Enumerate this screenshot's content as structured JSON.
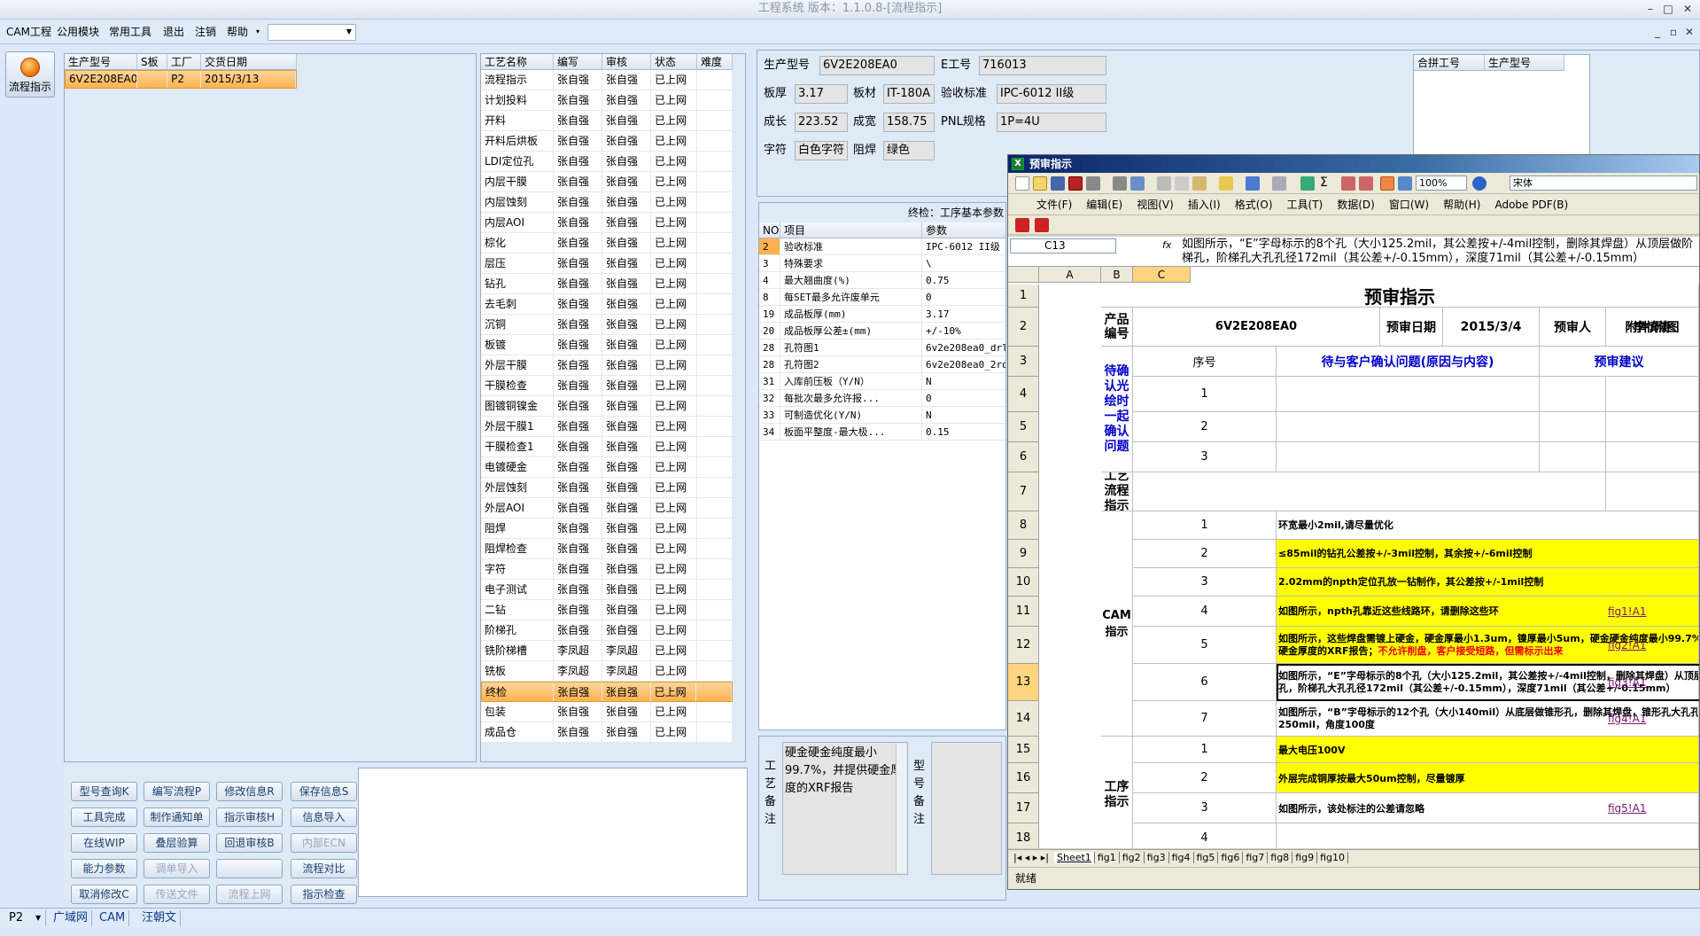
{
  "app": {
    "title": "工程系统 版本：1.1.0.8-[流程指示]"
  },
  "window_controls": {
    "min": "–",
    "max": "□",
    "close": "✕",
    "min2": "_",
    "restore2": "▫",
    "close2": "✕"
  },
  "menu": {
    "items": [
      "CAM工程",
      "公用模块",
      "常用工具",
      "退出",
      "注销",
      "帮助"
    ],
    "combo_value": ""
  },
  "side": {
    "flow_button": "流程指示"
  },
  "orders": {
    "headers": [
      "生产型号",
      "S板",
      "工厂",
      "交货日期"
    ],
    "rows": [
      [
        "6V2E208EA0",
        "",
        "P2",
        "2015/3/13"
      ]
    ]
  },
  "process": {
    "headers": [
      "工艺名称",
      "编写",
      "审核",
      "状态",
      "难度"
    ],
    "rows": [
      [
        "流程指示",
        "张自强",
        "张自强",
        "已上网",
        ""
      ],
      [
        "计划投料",
        "张自强",
        "张自强",
        "已上网",
        ""
      ],
      [
        "开料",
        "张自强",
        "张自强",
        "已上网",
        ""
      ],
      [
        "开料后烘板",
        "张自强",
        "张自强",
        "已上网",
        ""
      ],
      [
        "LDI定位孔",
        "张自强",
        "张自强",
        "已上网",
        ""
      ],
      [
        "内层干膜",
        "张自强",
        "张自强",
        "已上网",
        ""
      ],
      [
        "内层蚀刻",
        "张自强",
        "张自强",
        "已上网",
        ""
      ],
      [
        "内层AOI",
        "张自强",
        "张自强",
        "已上网",
        ""
      ],
      [
        "棕化",
        "张自强",
        "张自强",
        "已上网",
        ""
      ],
      [
        "层压",
        "张自强",
        "张自强",
        "已上网",
        ""
      ],
      [
        "钻孔",
        "张自强",
        "张自强",
        "已上网",
        ""
      ],
      [
        "去毛刺",
        "张自强",
        "张自强",
        "已上网",
        ""
      ],
      [
        "沉铜",
        "张自强",
        "张自强",
        "已上网",
        ""
      ],
      [
        "板镀",
        "张自强",
        "张自强",
        "已上网",
        ""
      ],
      [
        "外层干膜",
        "张自强",
        "张自强",
        "已上网",
        ""
      ],
      [
        "干膜检查",
        "张自强",
        "张自强",
        "已上网",
        ""
      ],
      [
        "图镀铜镍金",
        "张自强",
        "张自强",
        "已上网",
        ""
      ],
      [
        "外层干膜1",
        "张自强",
        "张自强",
        "已上网",
        ""
      ],
      [
        "干膜检查1",
        "张自强",
        "张自强",
        "已上网",
        ""
      ],
      [
        "电镀硬金",
        "张自强",
        "张自强",
        "已上网",
        ""
      ],
      [
        "外层蚀刻",
        "张自强",
        "张自强",
        "已上网",
        ""
      ],
      [
        "外层AOI",
        "张自强",
        "张自强",
        "已上网",
        ""
      ],
      [
        "阻焊",
        "张自强",
        "张自强",
        "已上网",
        ""
      ],
      [
        "阻焊检查",
        "张自强",
        "张自强",
        "已上网",
        ""
      ],
      [
        "字符",
        "张自强",
        "张自强",
        "已上网",
        ""
      ],
      [
        "电子测试",
        "张自强",
        "张自强",
        "已上网",
        ""
      ],
      [
        "二钻",
        "张自强",
        "张自强",
        "已上网",
        ""
      ],
      [
        "阶梯孔",
        "张自强",
        "张自强",
        "已上网",
        ""
      ],
      [
        "铣阶梯槽",
        "李凤超",
        "李凤超",
        "已上网",
        ""
      ],
      [
        "铣板",
        "李凤超",
        "李凤超",
        "已上网",
        ""
      ],
      [
        "终检",
        "张自强",
        "张自强",
        "已上网",
        ""
      ],
      [
        "包装",
        "张自强",
        "张自强",
        "已上网",
        ""
      ],
      [
        "成品仓",
        "张自强",
        "张自强",
        "已上网",
        ""
      ]
    ],
    "selected_index": 30
  },
  "buttons": [
    [
      "型号查询K",
      "编写流程P",
      "修改信息R",
      "保存信息S"
    ],
    [
      "工具完成",
      "制作通知单",
      "指示审核H",
      "信息导入"
    ],
    [
      "在线WIP",
      "叠层验算",
      "回退审核B",
      "内部ECN"
    ],
    [
      "能力参数",
      "调单导入",
      "",
      "流程对比"
    ],
    [
      "取消修改C",
      "传送文件",
      "流程上网",
      "指示检查"
    ]
  ],
  "disabled_buttons": [
    "内部ECN",
    "调单导入",
    "传送文件",
    "流程上网"
  ],
  "info": {
    "labels": {
      "model": "生产型号",
      "eno": "E工号",
      "thick": "板厚",
      "material": "板材",
      "accept": "验收标准",
      "len": "成长",
      "width": "成宽",
      "pnl": "PNL规格",
      "char": "字符",
      "mask": "阻焊"
    },
    "values": {
      "model": "6V2E208EA0",
      "eno": "716013",
      "thick": "3.17",
      "material": "IT-180A",
      "accept": "IPC-6012 II级",
      "len": "223.52",
      "width": "158.75",
      "pnl": "1P=4U",
      "char": "白色字符",
      "mask": "绿色"
    }
  },
  "merge": {
    "headers": [
      "合拼工号",
      "生产型号"
    ]
  },
  "params": {
    "caption": "终检：工序基本参数",
    "headers": [
      "NO",
      "项目",
      "参数"
    ],
    "rows": [
      [
        "2",
        "验收标准",
        "IPC-6012 II级"
      ],
      [
        "3",
        "特殊要求",
        "\\"
      ],
      [
        "4",
        "最大翘曲度(%)",
        "0.75"
      ],
      [
        "8",
        "每SET最多允许废单元",
        "0"
      ],
      [
        "19",
        "成品板厚(mm)",
        "3.17"
      ],
      [
        "20",
        "成品板厚公差±(mm)",
        "+/-10%"
      ],
      [
        "28",
        "孔符图1",
        "6v2e208ea0_drl_"
      ],
      [
        "28",
        "孔符图2",
        "6v2e208ea0_2rd_"
      ],
      [
        "31",
        "入库前压板（Y/N）",
        "N"
      ],
      [
        "32",
        "每批次最多允许报...",
        "0"
      ],
      [
        "33",
        "可制造优化(Y/N)",
        "N"
      ],
      [
        "34",
        "板面平整度-最大极...",
        "0.15"
      ]
    ],
    "selected_index": 0
  },
  "remark": {
    "label": "工艺备注",
    "text": "硬金硬金纯度最小99.7%，并提供硬金厚度的XRF报告",
    "label2": "型号备注"
  },
  "excel": {
    "title": "预审指示",
    "menu": [
      "文件(F)",
      "编辑(E)",
      "视图(V)",
      "插入(I)",
      "格式(O)",
      "工具(T)",
      "数据(D)",
      "窗口(W)",
      "帮助(H)",
      "Adobe PDF(B)"
    ],
    "zoom": "100%",
    "font": "宋体",
    "namebox": "C13",
    "fx": "fx",
    "formula": "如图所示，“E”字母标示的8个孔（大小125.2mil，其公差按+/-4mil控制，删除其焊盘）从顶层做阶梯孔，阶梯孔大孔孔径172mil（其公差+/-0.15mm），深度71mil（其公差+/-0.15mm）",
    "cols": [
      "A",
      "B",
      "C"
    ],
    "rows": [
      "1",
      "2",
      "3",
      "4",
      "5",
      "6",
      "7",
      "8",
      "9",
      "10",
      "11",
      "12",
      "13",
      "14",
      "15",
      "16",
      "17",
      "18",
      "5"
    ],
    "product_label": "产品编号",
    "product": "6V2E208EA0",
    "date_label": "预审日期",
    "date": "2015/3/4",
    "reviewer_label": "预审人",
    "reviewer": "李慎涛",
    "attach_label": "附件/附图",
    "seq_label": "序号",
    "issue_label": "待与客户确认问题(原因与内容)",
    "suggest_label": "预审建议",
    "pending_label": "待确认光绘时一起确认问题",
    "pending_seq": [
      "1",
      "2",
      "3"
    ],
    "flow_label": "工艺流程指示",
    "cam_label": "CAM指示",
    "proc_label": "工序指示",
    "cam_items": [
      {
        "n": "1",
        "t": "环宽最小2mil,请尽量优化",
        "y": false,
        "link": ""
      },
      {
        "n": "2",
        "t": "≤85mil的钻孔公差按+/-3mil控制，其余按+/-6mil控制",
        "y": true,
        "link": ""
      },
      {
        "n": "3",
        "t": "2.02mm的npth定位孔放一钻制作，其公差按+/-1mil控制",
        "y": true,
        "link": ""
      },
      {
        "n": "4",
        "t": "如图所示，npth孔靠近这些线路环，请删除这些环",
        "y": true,
        "link": "fig1!A1"
      },
      {
        "n": "5",
        "t": "如图所示，这些焊盘需镀上硬金，硬金厚最小1.3um，镍厚最小5um，硬金硬金纯度最小99.7%，并提供硬金厚度的XRF报告；",
        "red": "不允许削盘，客户接受短路，但需标示出来",
        "y": true,
        "link": "fig2!A1"
      },
      {
        "n": "6",
        "t": "如图所示，“E”字母标示的8个孔（大小125.2mil，其公差按+/-4mil控制，删除其焊盘）从顶层做阶梯孔，阶梯孔大孔孔径172mil（其公差+/-0.15mm），深度71mil（其公差+/-0.15mm）",
        "y": false,
        "link": "fig3!A1"
      },
      {
        "n": "7",
        "t": "如图所示，“B”字母标示的12个孔（大小140mil）从底层做锥形孔，删除其焊盘，锥形孔大孔孔径250mil，角度100度",
        "y": false,
        "link": "fig4!A1"
      }
    ],
    "proc_items": [
      {
        "n": "1",
        "t": "最大电压100V",
        "y": true,
        "link": ""
      },
      {
        "n": "2",
        "t": "外层完成铜厚按最大50um控制，尽量镀厚",
        "y": true,
        "link": ""
      },
      {
        "n": "3",
        "t": "如图所示，该处标注的公差请忽略",
        "y": false,
        "link": "fig5!A1"
      },
      {
        "n": "4",
        "t": "",
        "y": false,
        "link": ""
      }
    ],
    "tabs": [
      "Sheet1",
      "fig1",
      "fig2",
      "fig3",
      "fig4",
      "fig5",
      "fig6",
      "fig7",
      "fig8",
      "fig9",
      "fig10"
    ],
    "status": "就绪"
  },
  "taskbar": [
    "P2",
    "广域网",
    "CAM",
    "汪朝文"
  ]
}
